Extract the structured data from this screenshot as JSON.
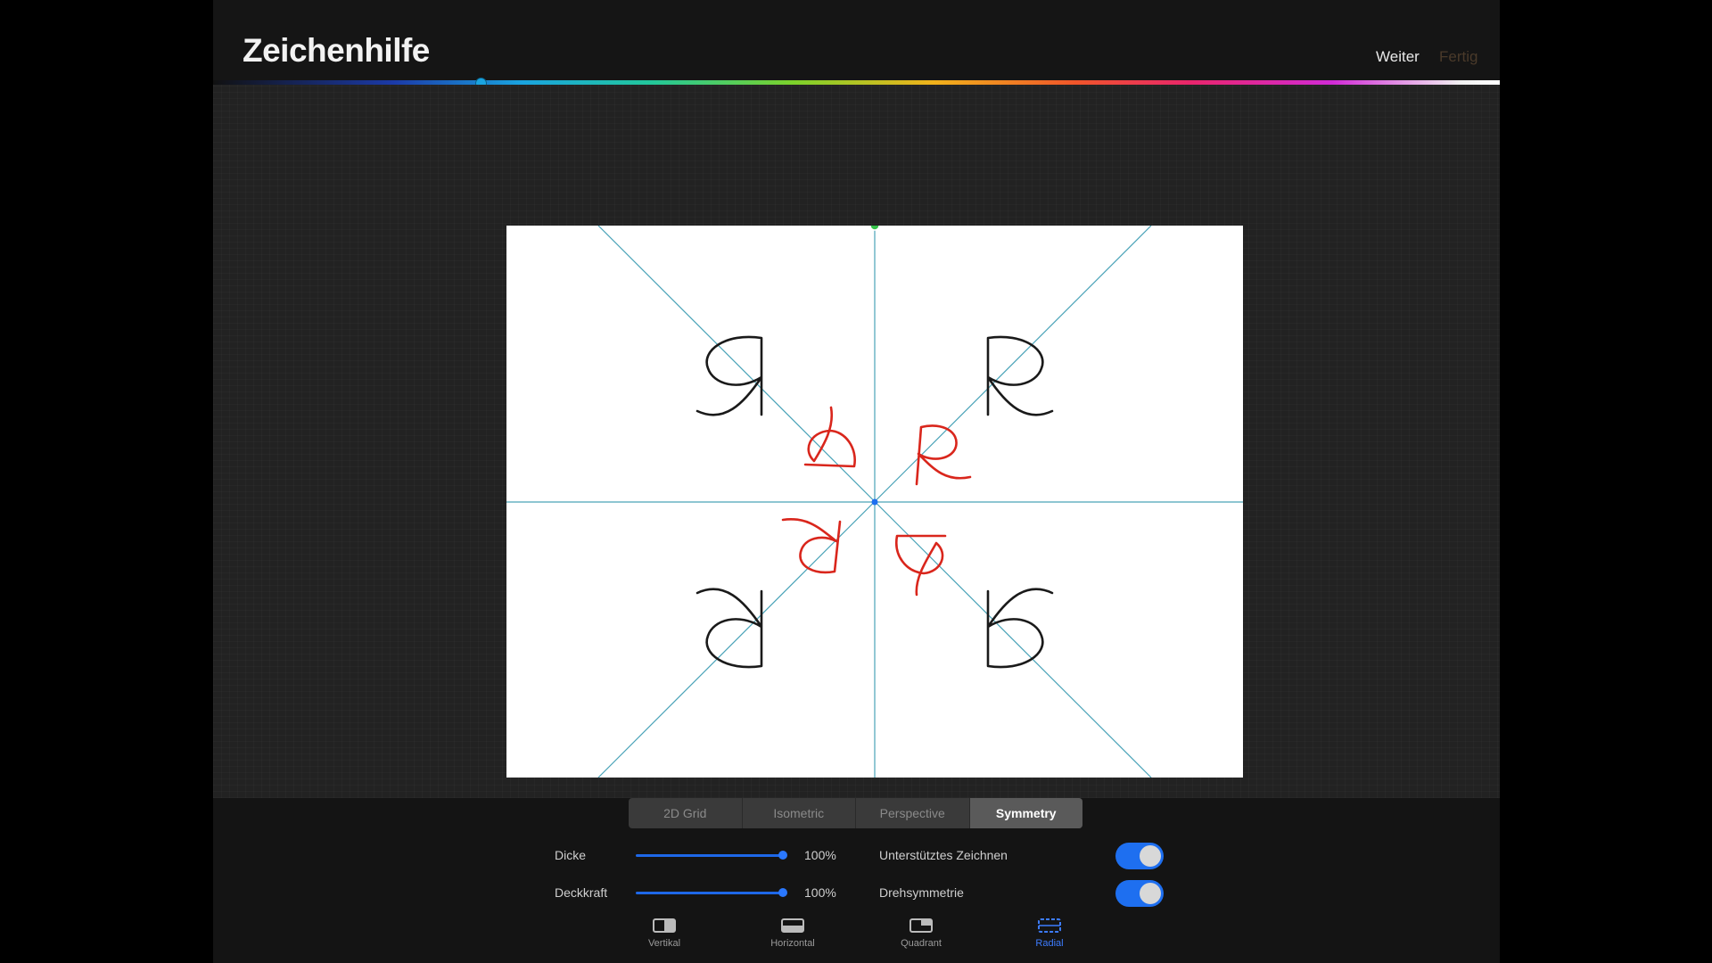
{
  "header": {
    "title": "Zeichenhilfe",
    "next_label": "Weiter",
    "done_label": "Fertig"
  },
  "colors": {
    "accent": "#1e6ff0",
    "guide_line": "#4aa3b8",
    "stroke_black": "#1a1a1a",
    "stroke_red": "#d9261c"
  },
  "tabs": [
    {
      "label": "2D Grid",
      "active": false
    },
    {
      "label": "Isometric",
      "active": false
    },
    {
      "label": "Perspective",
      "active": false
    },
    {
      "label": "Symmetry",
      "active": true
    }
  ],
  "settings": {
    "thickness": {
      "label": "Dicke",
      "value": "100%"
    },
    "opacity": {
      "label": "Deckkraft",
      "value": "100%"
    },
    "assisted_drawing": {
      "label": "Unterstütztes Zeichnen",
      "on": true
    },
    "rotational_symmetry": {
      "label": "Drehsymmetrie",
      "on": true
    }
  },
  "modes": [
    {
      "label": "Vertikal",
      "icon": "vertical-icon",
      "active": false
    },
    {
      "label": "Horizontal",
      "icon": "horizontal-icon",
      "active": false
    },
    {
      "label": "Quadrant",
      "icon": "quadrant-icon",
      "active": false
    },
    {
      "label": "Radial",
      "icon": "radial-icon",
      "active": true
    }
  ]
}
